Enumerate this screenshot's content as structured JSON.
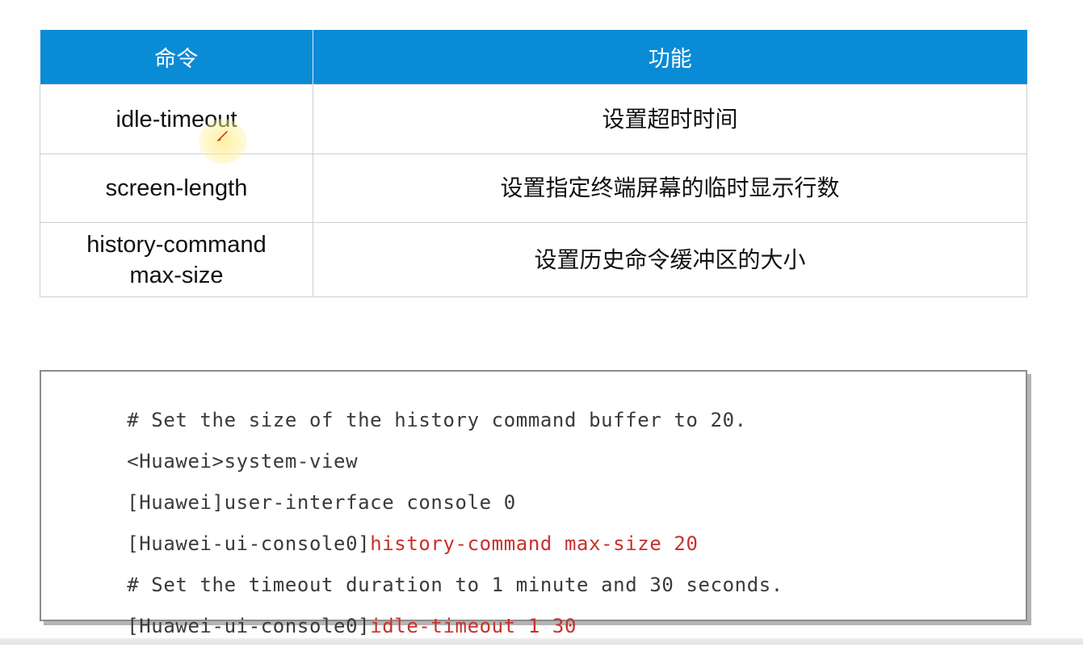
{
  "table": {
    "headers": [
      "命令",
      "功能"
    ],
    "rows": [
      {
        "command": "idle-timeout",
        "function": "设置超时时间"
      },
      {
        "command": "screen-length",
        "function": "设置指定终端屏幕的临时显示行数"
      },
      {
        "command": "history-command\nmax-size",
        "function": "设置历史命令缓冲区的大小"
      }
    ]
  },
  "code": {
    "lines": [
      {
        "prefix": "# Set the size of the history command buffer to 20.",
        "highlight": ""
      },
      {
        "prefix": "<Huawei>system-view",
        "highlight": ""
      },
      {
        "prefix": "[Huawei]user-interface console 0",
        "highlight": ""
      },
      {
        "prefix": "[Huawei-ui-console0]",
        "highlight": "history-command max-size 20"
      },
      {
        "prefix": "# Set the timeout duration to 1 minute and 30 seconds.",
        "highlight": ""
      },
      {
        "prefix": "[Huawei-ui-console0]",
        "highlight": "idle-timeout 1 30"
      }
    ]
  },
  "colors": {
    "header_bg": "#0a8bd6",
    "header_text": "#ffffff",
    "code_highlight": "#c8302c",
    "code_text": "#3a3a3a"
  }
}
